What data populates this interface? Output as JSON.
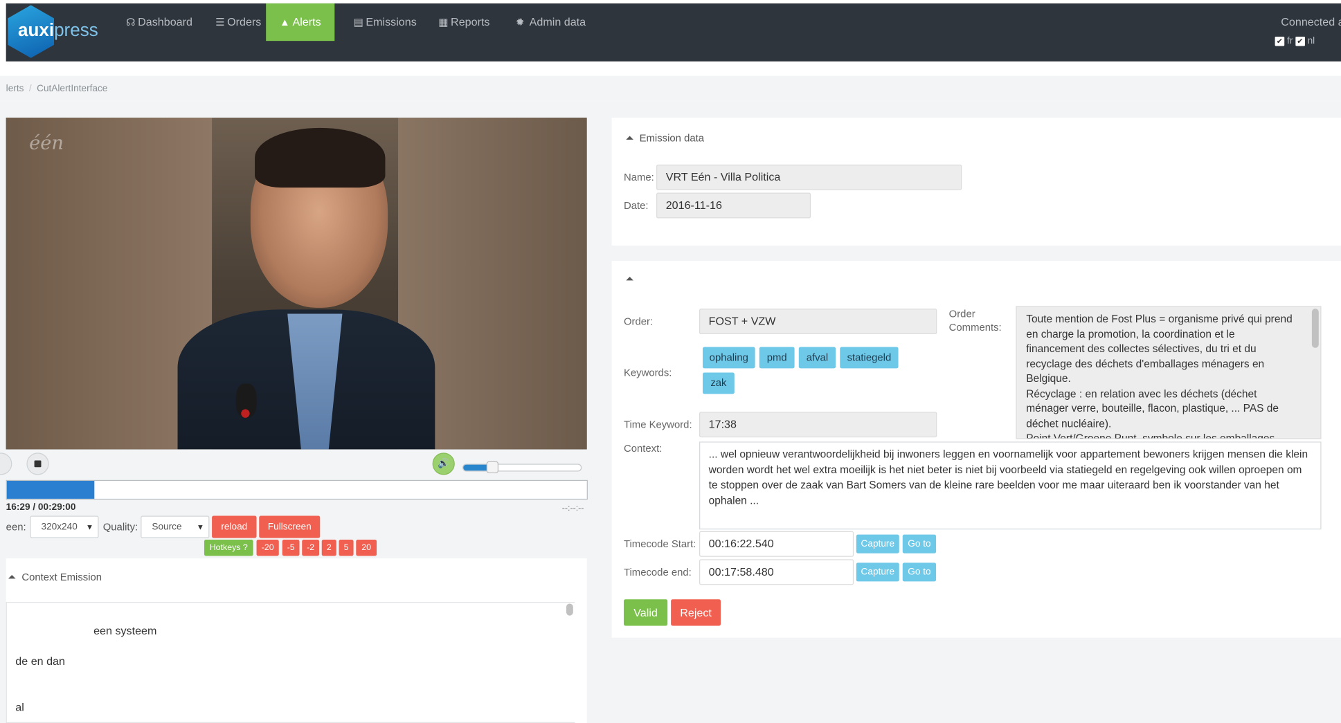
{
  "brand": {
    "part1": "auxi",
    "part2": "press"
  },
  "nav": {
    "items": [
      {
        "icon": "☊",
        "label": "Dashboard"
      },
      {
        "icon": "☰",
        "label": "Orders"
      },
      {
        "icon": "▲",
        "label": "Alerts"
      },
      {
        "icon": "▤",
        "label": "Emissions"
      },
      {
        "icon": "▦",
        "label": "Reports"
      },
      {
        "icon": "✹",
        "label": "Admin data"
      }
    ],
    "connected": "Connected as",
    "lang_fr": "fr",
    "lang_nl": "nl"
  },
  "breadcrumb": {
    "item1": "lerts",
    "item2": "CutAlertInterface"
  },
  "video": {
    "channel_logo": "één"
  },
  "player": {
    "progress_fraction": 0.151,
    "volume_fraction": 0.25,
    "time": "16:29 / 00:29:00",
    "time_right": "--:--:--",
    "screen_label": "een:",
    "screen_value": "320x240",
    "quality_label": "Quality:",
    "quality_value": "Source",
    "reload_label": "reload",
    "fullscreen_label": "Fullscreen",
    "hotkeys_label": "Hotkeys ?",
    "skips": [
      "-20",
      "-5",
      "-2",
      "2",
      "5",
      "20"
    ]
  },
  "context_emission": {
    "title": "Context Emission",
    "lines": [
      "een systeem",
      "de en dan",
      "al"
    ]
  },
  "emission_data": {
    "title": "Emission data",
    "name_label": "Name:",
    "name_value": "VRT Eén - Villa Politica",
    "date_label": "Date:",
    "date_value": "2016-11-16"
  },
  "alert": {
    "order_label": "Order:",
    "order_value": "FOST + VZW",
    "comments_label_1": "Order",
    "comments_label_2": "Comments:",
    "comments_text": "Toute mention de Fost Plus = organisme privé qui prend en charge la promotion, la coordination et le financement des collectes sélectives, du tri et du recyclage des déchets d'emballages ménagers en Belgique.\nRécyclage : en relation avec les déchets (déchet ménager verre, bouteille, flacon, plastique, ... PAS de déchet nucléaire).\nPoint Vert/Groene Punt, symbole sur les emballages",
    "keywords_label": "Keywords:",
    "keywords": [
      "ophaling",
      "pmd",
      "afval",
      "statiegeld",
      "zak"
    ],
    "time_keyword_label": "Time Keyword:",
    "time_keyword_value": "17:38",
    "context_label": "Context:",
    "context_text": "... wel opnieuw verantwoordelijkheid bij inwoners leggen en voornamelijk voor appartement bewoners krijgen mensen die klein worden wordt het wel extra moeilijk is het niet beter is niet bij voorbeeld via statiegeld en regelgeving ook willen oproepen om te stoppen over de zaak van Bart Somers van de kleine rare beelden voor me maar uiteraard ben ik voorstander van het ophalen ...",
    "tc_start_label": "Timecode Start:",
    "tc_start_value": "00:16:22.540",
    "tc_end_label": "Timecode end:",
    "tc_end_value": "00:17:58.480",
    "capture_label": "Capture",
    "goto_label": "Go to",
    "valid_label": "Valid",
    "reject_label": "Reject"
  },
  "colors": {
    "navbar": "#2f353c",
    "active_nav": "#7ac04a",
    "danger": "#f05f4f",
    "info": "#6ec8e8",
    "progress": "#2a7fd0"
  }
}
